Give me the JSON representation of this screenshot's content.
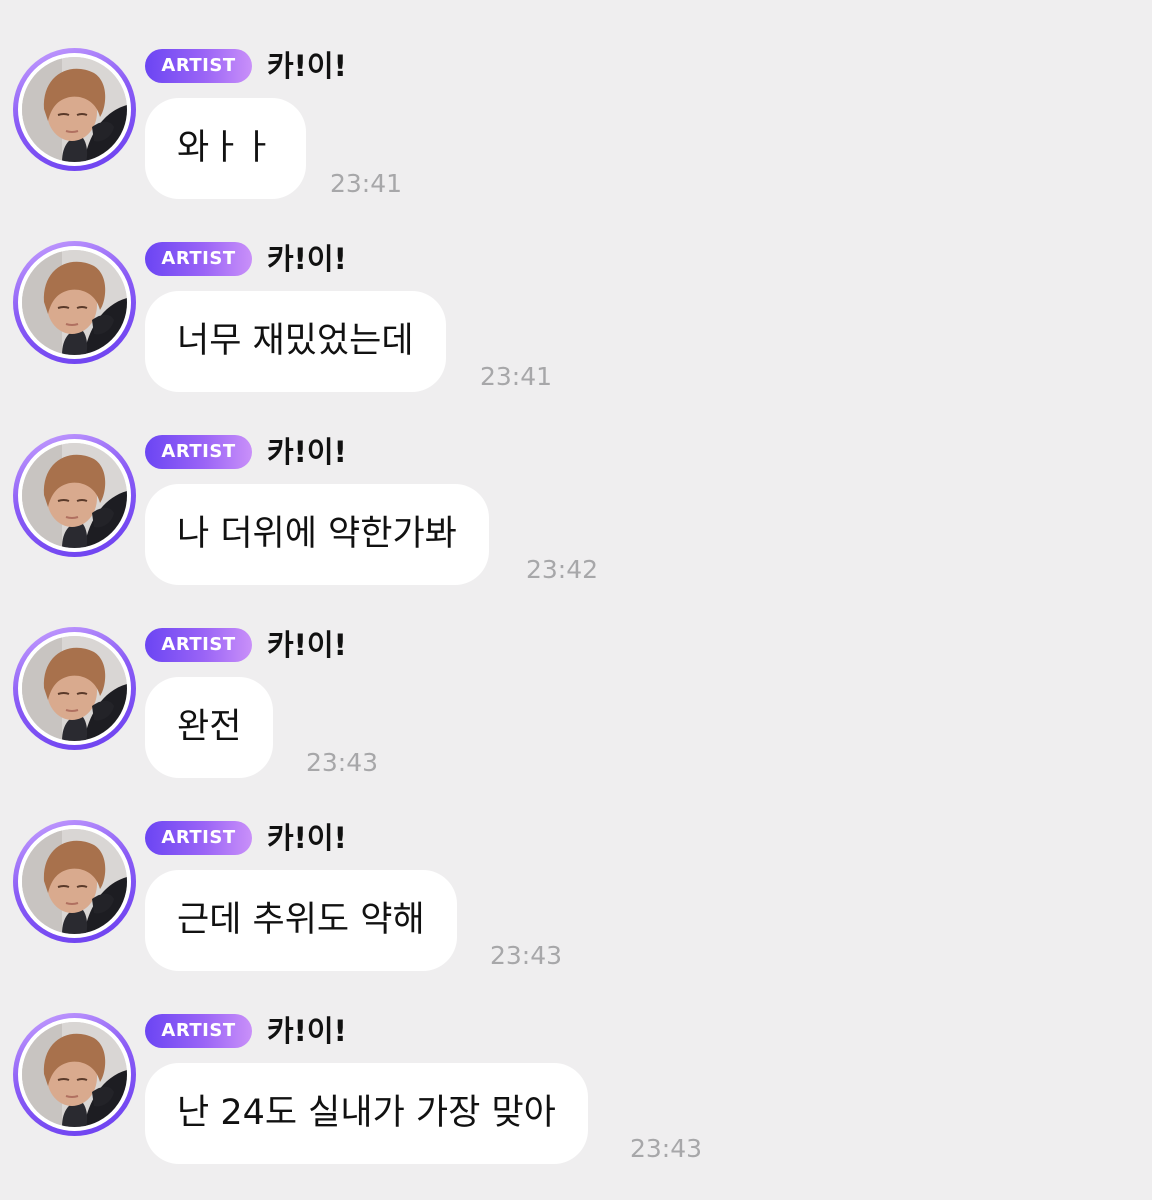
{
  "messages": [
    {
      "badge": "ARTIST",
      "sender": "카!이!",
      "text": "와ㅏㅏ",
      "time": "23:41"
    },
    {
      "badge": "ARTIST",
      "sender": "카!이!",
      "text": "너무 재밌었는데",
      "time": "23:41"
    },
    {
      "badge": "ARTIST",
      "sender": "카!이!",
      "text": "나 더위에 약한가봐",
      "time": "23:42"
    },
    {
      "badge": "ARTIST",
      "sender": "카!이!",
      "text": "완전",
      "time": "23:43"
    },
    {
      "badge": "ARTIST",
      "sender": "카!이!",
      "text": "근데 추위도 약해",
      "time": "23:43"
    },
    {
      "badge": "ARTIST",
      "sender": "카!이!",
      "text": "난 24도 실내가 가장 맞아",
      "time": "23:43"
    }
  ],
  "colors": {
    "background": "#efeeef",
    "bubble": "#ffffff",
    "badge_start": "#6b45f3",
    "badge_end": "#c990f9",
    "timestamp": "#a7a7a9"
  }
}
